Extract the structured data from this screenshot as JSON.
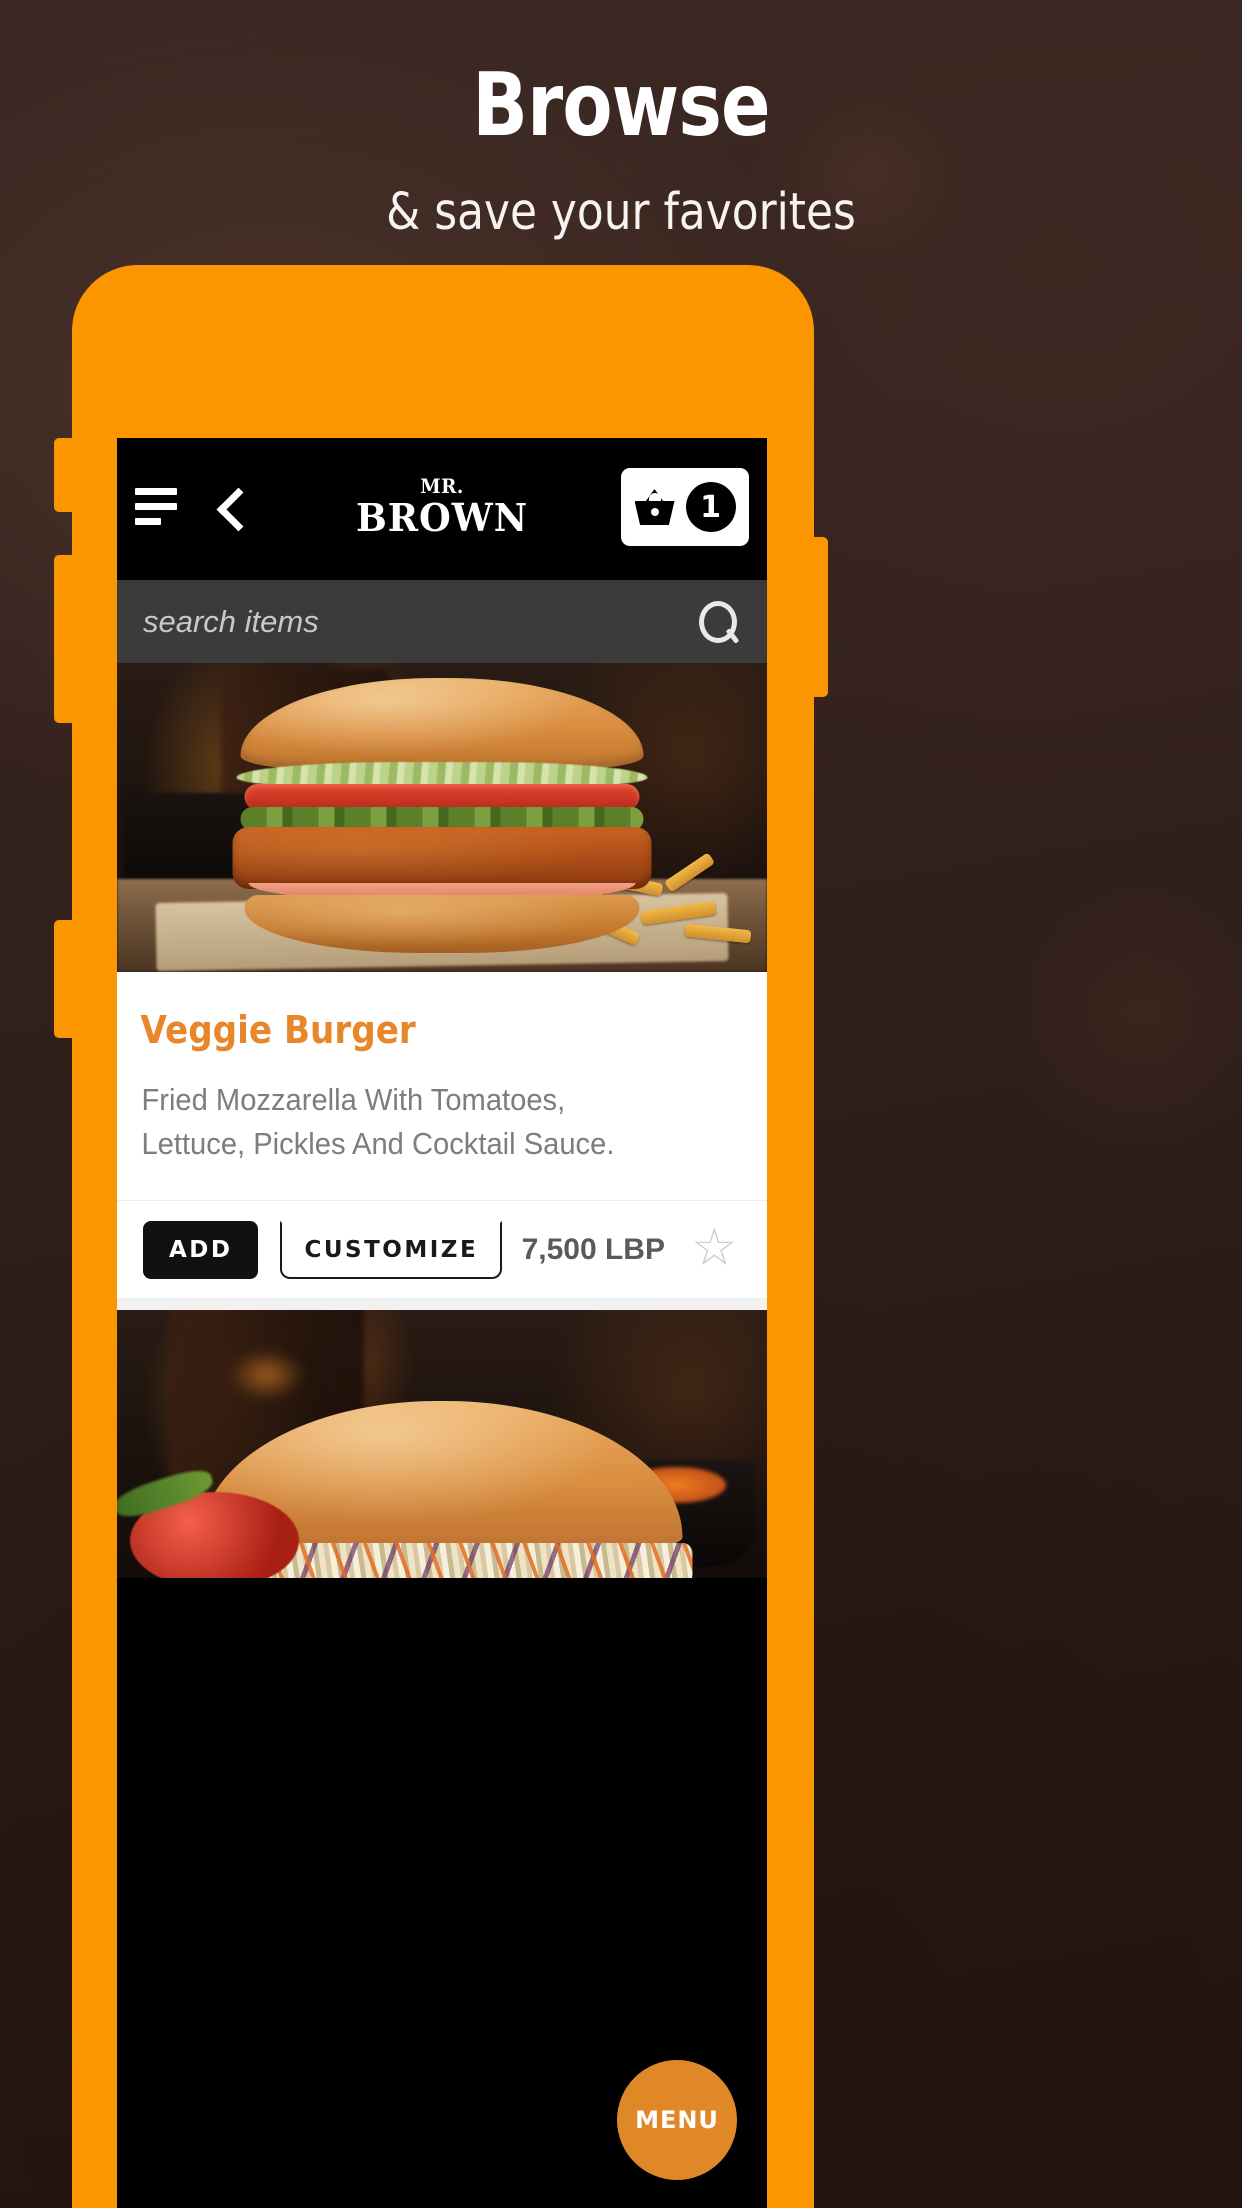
{
  "hero": {
    "title": "Browse",
    "subtitle": "& save your favorites"
  },
  "colors": {
    "phone_frame": "#fb9600",
    "accent_orange": "#e8862a",
    "fab_orange": "#e08828",
    "app_bar": "#000000",
    "search_bar": "#3b3b3b",
    "backdrop": "#2b1d19"
  },
  "appbar": {
    "menu_icon": "hamburger-icon",
    "back_icon": "chevron-left-icon",
    "brand_line1": "MR.",
    "brand_line2": "BROWN",
    "cart_icon": "shopping-basket-icon",
    "cart_count": "1"
  },
  "search": {
    "placeholder": "search items",
    "value": "",
    "icon": "search-icon"
  },
  "items": [
    {
      "name": "Veggie Burger",
      "description": "Fried Mozzarella With Tomatoes, Lettuce, Pickles And Cocktail Sauce.",
      "add_label": "ADD",
      "customize_label": "CUSTOMIZE",
      "price": "7,500 LBP",
      "favorite_icon": "star-outline-icon"
    }
  ],
  "fab": {
    "label": "MENU"
  }
}
